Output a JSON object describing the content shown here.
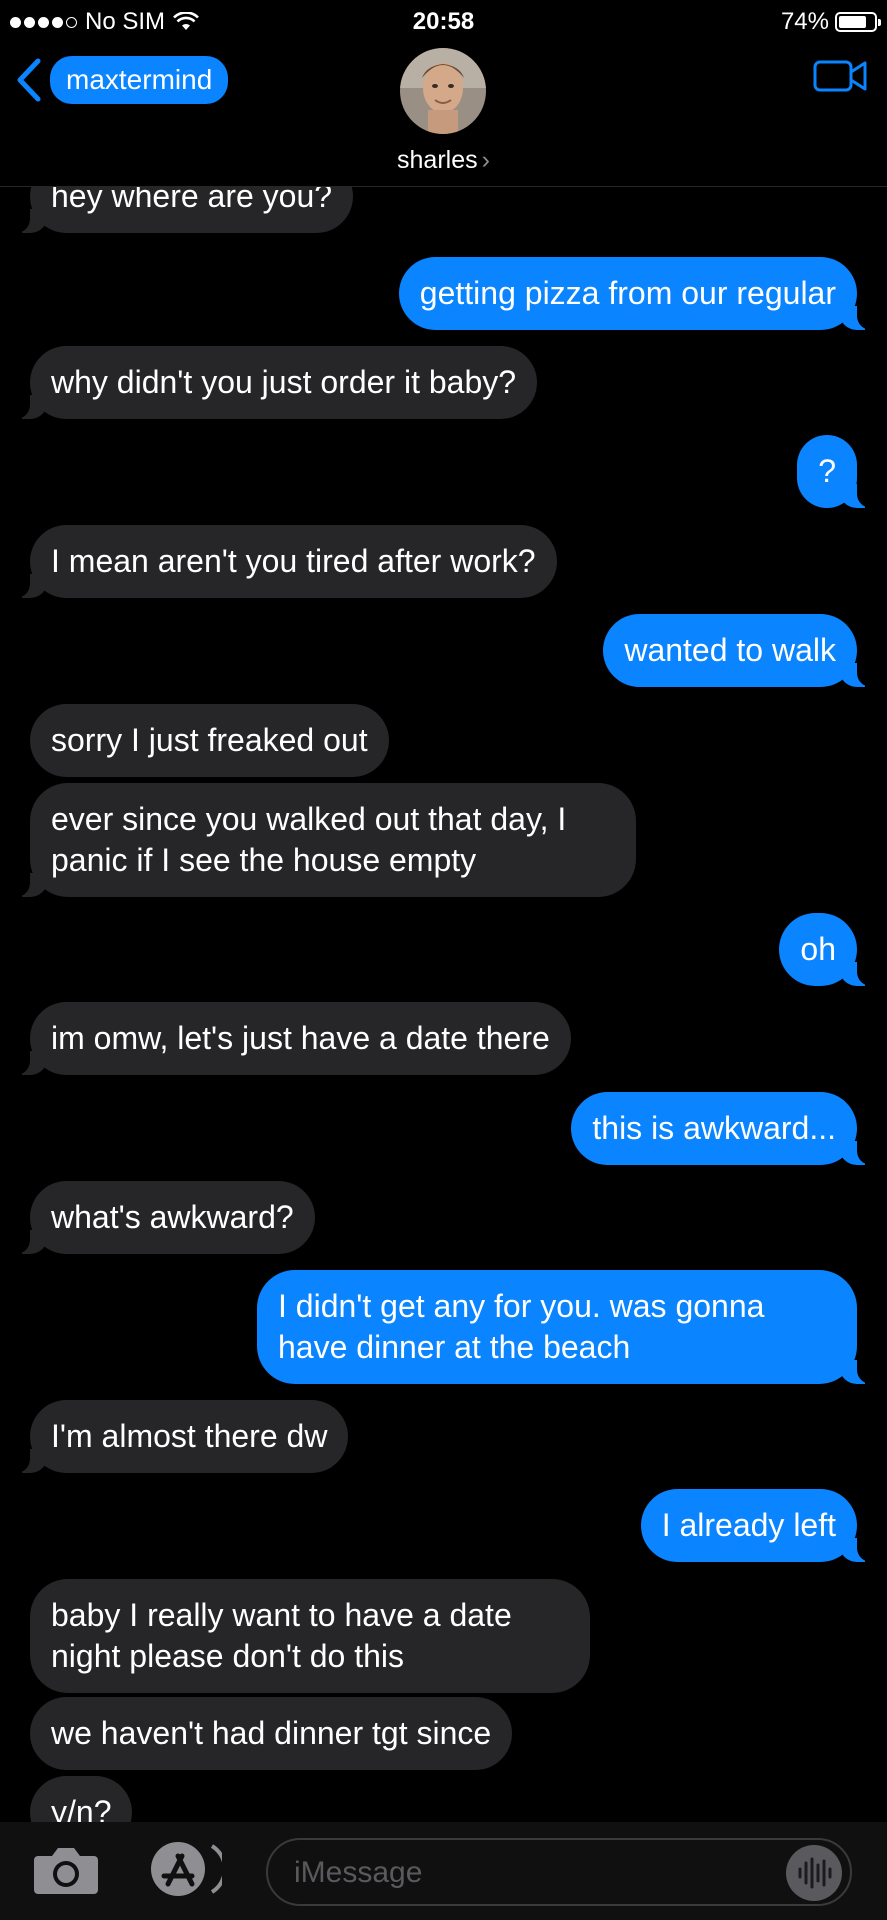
{
  "status_bar": {
    "carrier": "No SIM",
    "time": "20:58",
    "battery": "74%"
  },
  "header": {
    "back_label": "maxtermind",
    "contact_name": "sharles"
  },
  "messages": [
    {
      "side": "received",
      "text": "hey where are you?"
    },
    {
      "side": "sent",
      "text": "getting pizza from our regular"
    },
    {
      "side": "received",
      "text": "why didn't you just order it baby?"
    },
    {
      "side": "sent",
      "text": "?"
    },
    {
      "side": "received",
      "text": "I mean aren't you tired after work?"
    },
    {
      "side": "sent",
      "text": "wanted to walk"
    },
    {
      "side": "received",
      "text": "sorry I just freaked out"
    },
    {
      "side": "received",
      "text": "ever since you walked out that day, I panic if I see the house empty"
    },
    {
      "side": "sent",
      "text": "oh"
    },
    {
      "side": "received",
      "text": "im omw, let's just have a date there"
    },
    {
      "side": "sent",
      "text": "this is awkward..."
    },
    {
      "side": "received",
      "text": "what's awkward?"
    },
    {
      "side": "sent",
      "text": "I didn't get any for you. was gonna have dinner at the beach"
    },
    {
      "side": "received",
      "text": "I'm almost there dw"
    },
    {
      "side": "sent",
      "text": "I already left"
    },
    {
      "side": "received",
      "text": "baby I really want to have a date night please don't do this"
    },
    {
      "side": "received",
      "text": "we haven't had dinner tgt since"
    },
    {
      "side": "received",
      "text": "y/n?"
    }
  ],
  "input": {
    "placeholder": "iMessage"
  },
  "colors": {
    "sent_bubble": "#0a84ff",
    "received_bubble": "#262628",
    "background": "#000000"
  }
}
